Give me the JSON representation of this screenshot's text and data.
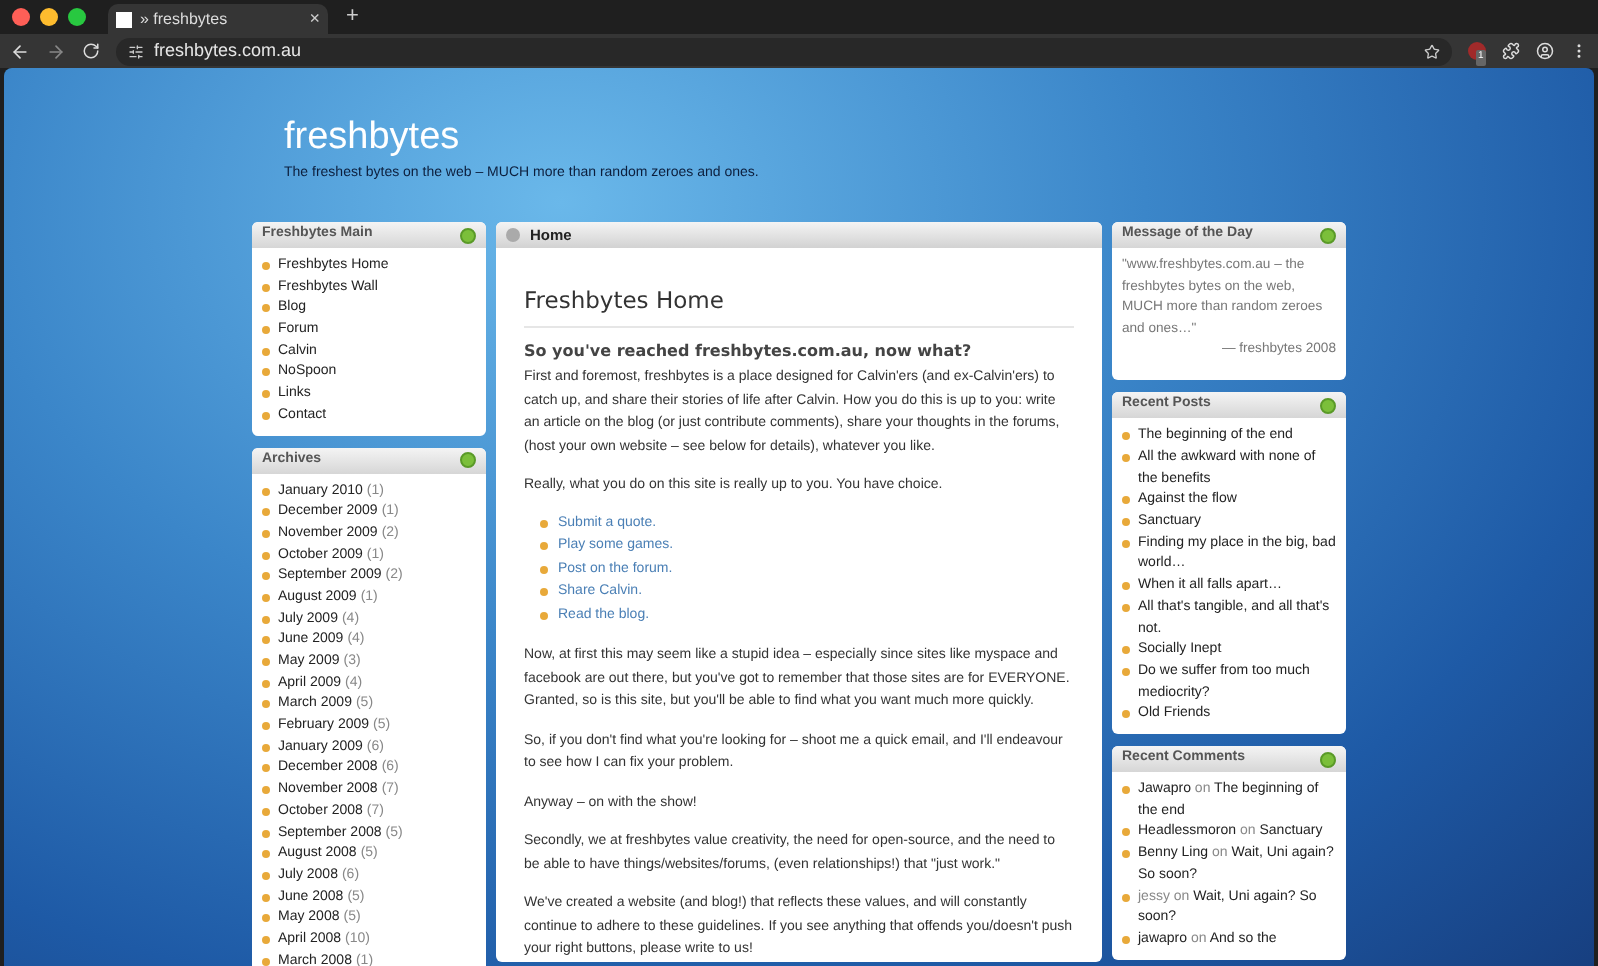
{
  "browser": {
    "tab_title": "» freshbytes",
    "tab_close": "×",
    "new_tab": "+",
    "url": "freshbytes.com.au",
    "extension_badge": "1"
  },
  "site": {
    "title": "freshbytes",
    "tagline": "The freshest bytes on the web – MUCH more than random zeroes and ones."
  },
  "main_menu": {
    "title": "Freshbytes Main",
    "items": [
      "Freshbytes Home",
      "Freshbytes Wall",
      "Blog",
      "Forum",
      "Calvin",
      "NoSpoon",
      "Links",
      "Contact"
    ]
  },
  "archives": {
    "title": "Archives",
    "items": [
      {
        "label": "January 2010",
        "count": "(1)"
      },
      {
        "label": "December 2009",
        "count": "(1)"
      },
      {
        "label": "November 2009",
        "count": "(2)"
      },
      {
        "label": "October 2009",
        "count": "(1)"
      },
      {
        "label": "September 2009",
        "count": "(2)"
      },
      {
        "label": "August 2009",
        "count": "(1)"
      },
      {
        "label": "July 2009",
        "count": "(4)"
      },
      {
        "label": "June 2009",
        "count": "(4)"
      },
      {
        "label": "May 2009",
        "count": "(3)"
      },
      {
        "label": "April 2009",
        "count": "(4)"
      },
      {
        "label": "March 2009",
        "count": "(5)"
      },
      {
        "label": "February 2009",
        "count": "(5)"
      },
      {
        "label": "January 2009",
        "count": "(6)"
      },
      {
        "label": "December 2008",
        "count": "(6)"
      },
      {
        "label": "November 2008",
        "count": "(7)"
      },
      {
        "label": "October 2008",
        "count": "(7)"
      },
      {
        "label": "September 2008",
        "count": "(5)"
      },
      {
        "label": "August 2008",
        "count": "(5)"
      },
      {
        "label": "July 2008",
        "count": "(6)"
      },
      {
        "label": "June 2008",
        "count": "(5)"
      },
      {
        "label": "May 2008",
        "count": "(5)"
      },
      {
        "label": "April 2008",
        "count": "(10)"
      },
      {
        "label": "March 2008",
        "count": "(1)"
      }
    ]
  },
  "content": {
    "tab": "Home",
    "heading": "Freshbytes Home",
    "subheading": "So you've reached freshbytes.com.au, now what?",
    "blocks": [
      {
        "kind": "paragraph",
        "text": "First and foremost, freshbytes is a place designed for Calvin'ers (and ex-Calvin'ers) to catch up, and share their stories of life after Calvin. How you do this is up to you: write an article on the blog (or just contribute comments), share your thoughts in the forums, (host your own website – see below for details), whatever you like."
      },
      {
        "kind": "paragraph",
        "text": "Really, what you do on this site is really up to you. You have choice."
      },
      {
        "kind": "links",
        "items": [
          "Submit a quote.",
          "Play some games.",
          "Post on the forum.",
          "Share Calvin.",
          "Read the blog."
        ]
      },
      {
        "kind": "paragraph",
        "text": "Now, at first this may seem like a stupid idea – especially since sites like myspace and facebook are out there, but you've got to remember that those sites are for EVERYONE. Granted, so is this site, but you'll be able to find what you want much more quickly."
      },
      {
        "kind": "paragraph",
        "text": "So, if you don't find what you're looking for – shoot me a quick email, and I'll endeavour to see how I can fix your problem."
      },
      {
        "kind": "paragraph",
        "text": "Anyway – on with the show!"
      },
      {
        "kind": "paragraph",
        "text": "Secondly, we at freshbytes value creativity, the need for open-source, and the need to be able to have things/websites/forums, (even relationships!) that \"just work.\""
      },
      {
        "kind": "paragraph",
        "text": "We've created a website (and blog!) that reflects these values, and will constantly continue to adhere to these guidelines. If you see anything that offends you/doesn't push your right buttons, please write to us!"
      }
    ]
  },
  "motd": {
    "title": "Message of the Day",
    "quote": "\"www.freshbytes.com.au – the freshbytes bytes on the web, MUCH more than random zeroes and ones…\"",
    "attribution": "— freshbytes 2008"
  },
  "recent_posts": {
    "title": "Recent Posts",
    "items": [
      "The beginning of the end",
      "All the awkward with none of the benefits",
      "Against the flow",
      "Sanctuary",
      "Finding my place in the big, bad world…",
      "When it all falls apart…",
      "All that's tangible, and all that's not.",
      "Socially Inept",
      "Do we suffer from too much mediocrity?",
      "Old Friends"
    ]
  },
  "recent_comments": {
    "title": "Recent Comments",
    "items": [
      {
        "author": "Jawapro",
        "connector": "on",
        "post": "The beginning of the end",
        "plain_author": false
      },
      {
        "author": "Headlessmoron",
        "connector": "on",
        "post": "Sanctuary",
        "plain_author": false
      },
      {
        "author": "Benny Ling",
        "connector": "on",
        "post": "Wait, Uni again? So soon?",
        "plain_author": false
      },
      {
        "author": "jessy",
        "connector": "on",
        "post": "Wait, Uni again? So soon?",
        "plain_author": true
      },
      {
        "author": "jawapro",
        "connector": "on",
        "post": "And so the",
        "plain_author": false
      }
    ]
  }
}
